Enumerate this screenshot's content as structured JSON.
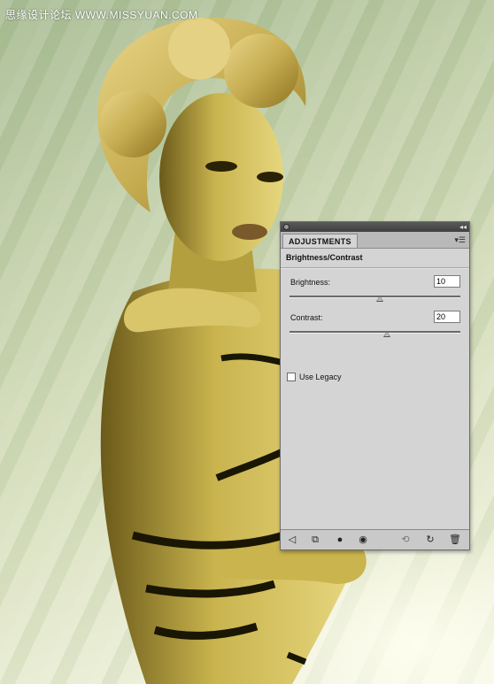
{
  "watermark": "思缘设计论坛  WWW.MISSYUAN.COM",
  "panel": {
    "tab_label": "ADJUSTMENTS",
    "adjustment_name": "Brightness/Contrast",
    "brightness": {
      "label": "Brightness:",
      "value": "10",
      "slider_fraction": 0.53
    },
    "contrast": {
      "label": "Contrast:",
      "value": "20",
      "slider_fraction": 0.57
    },
    "use_legacy_label": "Use Legacy",
    "use_legacy_checked": false,
    "bottom_icons": [
      "return-arrow-icon",
      "expand-view-icon",
      "clip-layer-icon",
      "visibility-eye-icon",
      "previous-state-icon",
      "reset-icon",
      "delete-icon"
    ]
  },
  "colors": {
    "panel_bg": "#d4d4d4",
    "titlebar": "#3f3f3f",
    "tint": "#c8b84a"
  }
}
